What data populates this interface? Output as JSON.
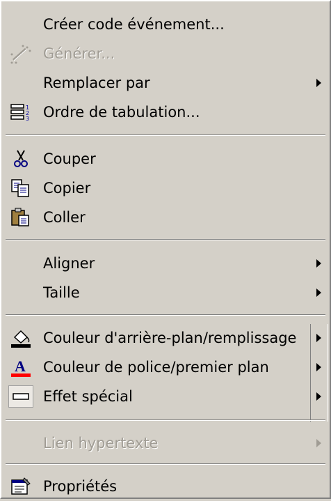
{
  "menu": {
    "items": [
      {
        "id": "creer",
        "label": "Créer code événement...",
        "disabled": false,
        "submenu": false,
        "icon": null
      },
      {
        "id": "generer",
        "label": "Générer...",
        "disabled": true,
        "submenu": false,
        "icon": "wizard-icon"
      },
      {
        "id": "remplacer",
        "label": "Remplacer par",
        "disabled": false,
        "submenu": true,
        "icon": null
      },
      {
        "id": "ordre",
        "label": "Ordre de tabulation...",
        "disabled": false,
        "submenu": false,
        "icon": "tab-order-icon"
      },
      {
        "id": "couper",
        "label": "Couper",
        "disabled": false,
        "submenu": false,
        "icon": "scissors-icon"
      },
      {
        "id": "copier",
        "label": "Copier",
        "disabled": false,
        "submenu": false,
        "icon": "copy-icon"
      },
      {
        "id": "coller",
        "label": "Coller",
        "disabled": false,
        "submenu": false,
        "icon": "paste-icon"
      },
      {
        "id": "aligner",
        "label": "Aligner",
        "disabled": false,
        "submenu": true,
        "icon": null
      },
      {
        "id": "taille",
        "label": "Taille",
        "disabled": false,
        "submenu": true,
        "icon": null
      },
      {
        "id": "couleur_fond",
        "label": "Couleur d'arrière-plan/remplissage",
        "disabled": false,
        "submenu": true,
        "icon": "fill-color-icon"
      },
      {
        "id": "couleur_police",
        "label": "Couleur de police/premier plan",
        "disabled": false,
        "submenu": true,
        "icon": "font-color-icon"
      },
      {
        "id": "effet",
        "label": "Effet spécial",
        "disabled": false,
        "submenu": true,
        "icon": "special-effect-icon"
      },
      {
        "id": "lien",
        "label": "Lien hypertexte",
        "disabled": true,
        "submenu": true,
        "icon": null
      },
      {
        "id": "proprietes",
        "label": "Propriétés",
        "disabled": false,
        "submenu": false,
        "icon": "properties-icon"
      }
    ]
  },
  "colors": {
    "menu_bg": "#d4d0c8",
    "disabled_text": "#a09c94",
    "font_color_bar": "#ff0000",
    "fill_color_bar": "#000000"
  }
}
